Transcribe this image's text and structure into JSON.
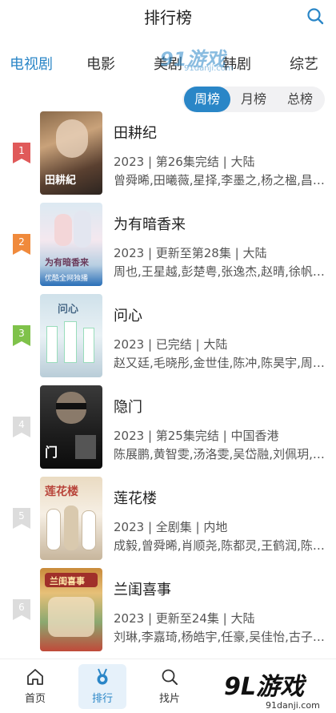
{
  "header": {
    "title": "排行榜"
  },
  "category_tabs": [
    {
      "label": "电视剧",
      "active": true
    },
    {
      "label": "电影",
      "active": false
    },
    {
      "label": "美剧",
      "active": false
    },
    {
      "label": "韩剧",
      "active": false
    },
    {
      "label": "综艺",
      "active": false
    }
  ],
  "period_tabs": [
    {
      "label": "周榜",
      "active": true
    },
    {
      "label": "月榜",
      "active": false
    },
    {
      "label": "总榜",
      "active": false
    }
  ],
  "watermark": {
    "top_logo": "91游戏",
    "top_sub": "91danji.com",
    "bottom_logo": "9L游戏",
    "bottom_sub": "91danji.com"
  },
  "rankings": [
    {
      "rank": "1",
      "title": "田耕纪",
      "meta": "2023 | 第26集完结 | 大陆",
      "cast": "曾舜晞,田曦薇,星择,李墨之,杨之楹,昌…",
      "poster_caption": "田耕紀",
      "flag_color": "#e05a5a"
    },
    {
      "rank": "2",
      "title": "为有暗香来",
      "meta": "2023 | 更新至第28集 | 大陆",
      "cast": "周也,王星越,彭楚粤,张逸杰,赵晴,徐帆,…",
      "poster_caption": "为有暗香来",
      "poster_sub": "优酷全网独播",
      "flag_color": "#f08a3c"
    },
    {
      "rank": "3",
      "title": "问心",
      "meta": "2023 | 已完结 | 大陆",
      "cast": "赵又廷,毛晓彤,金世佳,陈冲,陈昊宇,周…",
      "poster_caption": "问心",
      "flag_color": "#7fc24a"
    },
    {
      "rank": "4",
      "title": "隐门",
      "meta": "2023 | 第25集完结 | 中国香港",
      "cast": "陈展鹏,黄智雯,汤洛雯,吴岱融,刘佩玥,…",
      "poster_caption": "门",
      "flag_color": "#dcdcdc"
    },
    {
      "rank": "5",
      "title": "莲花楼",
      "meta": "2023 | 全剧集 | 内地",
      "cast": "成毅,曾舜晞,肖顺尧,陈都灵,王鹤润,陈…",
      "poster_caption": "莲花楼",
      "flag_color": "#dcdcdc"
    },
    {
      "rank": "6",
      "title": "兰闺喜事",
      "meta": "2023 | 更新至24集 | 大陆",
      "cast": "刘琳,李嘉琦,杨皓宇,任豪,吴佳怡,古子…",
      "poster_caption": "兰闺喜事",
      "flag_color": "#dcdcdc"
    }
  ],
  "bottom_nav": [
    {
      "label": "首页",
      "icon": "home-icon",
      "active": false
    },
    {
      "label": "排行",
      "icon": "medal-icon",
      "active": true
    },
    {
      "label": "找片",
      "icon": "search-icon",
      "active": false
    }
  ],
  "colors": {
    "accent": "#2a86c7"
  }
}
